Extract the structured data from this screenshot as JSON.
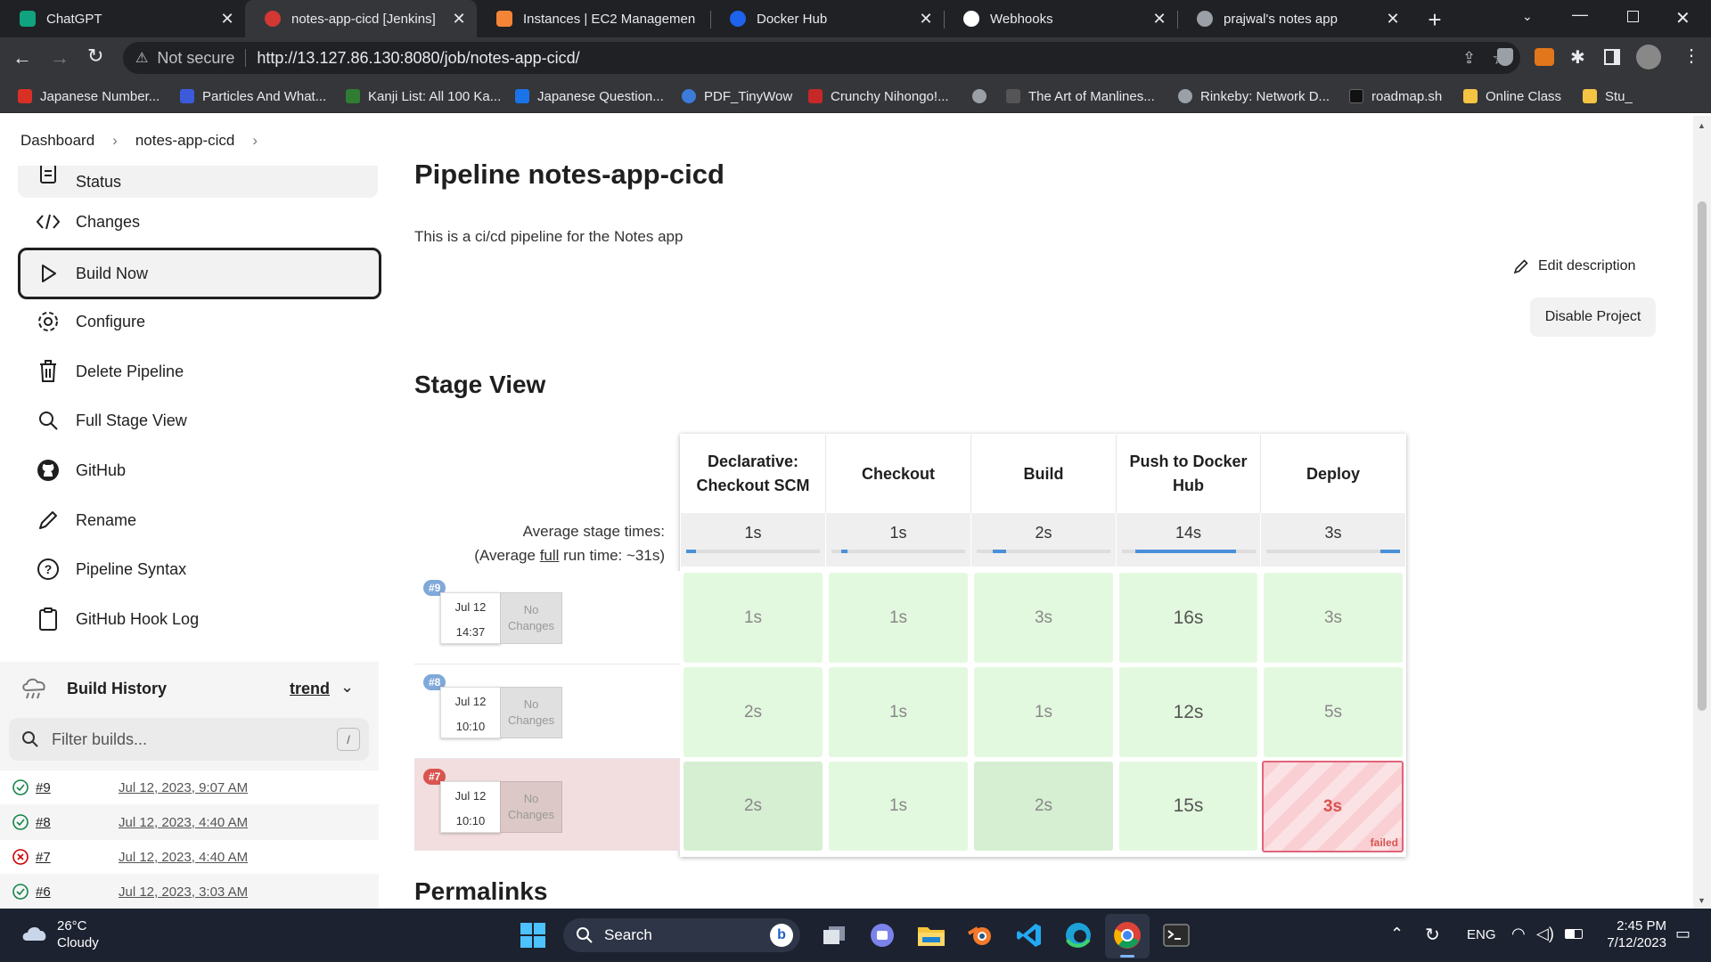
{
  "browser": {
    "tabs": [
      {
        "title": "ChatGPT",
        "favicon_color": "#10a37f"
      },
      {
        "title": "notes-app-cicd [Jenkins]",
        "favicon_color": "#d33833"
      },
      {
        "title": "Instances | EC2 Managemen",
        "favicon_color": "#f58536"
      },
      {
        "title": "Docker Hub",
        "favicon_color": "#1d63ed"
      },
      {
        "title": "Webhooks",
        "favicon_color": "#ffffff"
      },
      {
        "title": "prajwal's notes app",
        "favicon_color": "#9aa0a6"
      }
    ],
    "active_tab": 1,
    "security_label": "Not secure",
    "url": "http://13.127.86.130:8080/job/notes-app-cicd/",
    "bookmarks": [
      {
        "label": "Japanese Number...",
        "color": "#d93025"
      },
      {
        "label": "Particles And What...",
        "color": "#3b5bdb"
      },
      {
        "label": "Kanji List: All 100 Ka...",
        "color": "#2e7d32"
      },
      {
        "label": "Japanese Question...",
        "color": "#1a73e8"
      },
      {
        "label": "PDF_TinyWow",
        "color": "#3c7bd9"
      },
      {
        "label": "Crunchy Nihongo!...",
        "color": "#c62828"
      },
      {
        "label": "",
        "color": "#9aa0a6"
      },
      {
        "label": "The Art of Manlines...",
        "color": "#555555"
      },
      {
        "label": "Rinkeby: Network D...",
        "color": "#9aa0a6"
      },
      {
        "label": "roadmap.sh",
        "color": "#111111"
      },
      {
        "label": "Online Class",
        "color": "#f6c443"
      },
      {
        "label": "Stu_",
        "color": "#f6c443"
      }
    ]
  },
  "breadcrumb": [
    "Dashboard",
    "notes-app-cicd"
  ],
  "sidebar": {
    "items": [
      {
        "label": "Status",
        "icon": "document-icon"
      },
      {
        "label": "Changes",
        "icon": "code-icon"
      },
      {
        "label": "Build Now",
        "icon": "play-icon"
      },
      {
        "label": "Configure",
        "icon": "gear-icon"
      },
      {
        "label": "Delete Pipeline",
        "icon": "trash-icon"
      },
      {
        "label": "Full Stage View",
        "icon": "search-icon"
      },
      {
        "label": "GitHub",
        "icon": "github-icon"
      },
      {
        "label": "Rename",
        "icon": "pencil-icon"
      },
      {
        "label": "Pipeline Syntax",
        "icon": "help-icon"
      },
      {
        "label": "GitHub Hook Log",
        "icon": "clipboard-icon"
      }
    ],
    "build_history": {
      "title": "Build History",
      "trend_label": "trend",
      "filter_placeholder": "Filter builds...",
      "filter_shortcut": "/",
      "builds": [
        {
          "number": "#9",
          "date": "Jul 12, 2023, 9:07 AM",
          "status": "success"
        },
        {
          "number": "#8",
          "date": "Jul 12, 2023, 4:40 AM",
          "status": "success"
        },
        {
          "number": "#7",
          "date": "Jul 12, 2023, 4:40 AM",
          "status": "failed"
        },
        {
          "number": "#6",
          "date": "Jul 12, 2023, 3:03 AM",
          "status": "success"
        }
      ]
    }
  },
  "main": {
    "title": "Pipeline notes-app-cicd",
    "description": "This is a ci/cd pipeline for the Notes app",
    "edit_description": "Edit description",
    "disable_project": "Disable Project",
    "stage_view_title": "Stage View",
    "avg_stage_label": "Average stage times:",
    "avg_run_prefix": "(Average ",
    "avg_run_link": "full",
    "avg_run_suffix": " run time: ~31s)",
    "stages": [
      {
        "name": "Declarative: Checkout SCM",
        "avg": "1s",
        "bar_start": 0.0,
        "bar_fill": 0.07
      },
      {
        "name": "Checkout",
        "avg": "1s",
        "bar_start": 0.07,
        "bar_fill": 0.05
      },
      {
        "name": "Build",
        "avg": "2s",
        "bar_start": 0.12,
        "bar_fill": 0.1
      },
      {
        "name": "Push to Docker Hub",
        "avg": "14s",
        "bar_start": 0.1,
        "bar_fill": 0.75
      },
      {
        "name": "Deploy",
        "avg": "3s",
        "bar_start": 0.85,
        "bar_fill": 0.15
      }
    ],
    "runs": [
      {
        "badge": "#9",
        "date": "Jul 12",
        "time": "14:37",
        "changes": "No Changes",
        "status": "success",
        "durations": [
          "1s",
          "1s",
          "3s",
          "16s",
          "3s"
        ]
      },
      {
        "badge": "#8",
        "date": "Jul 12",
        "time": "10:10",
        "changes": "No Changes",
        "status": "success",
        "durations": [
          "2s",
          "1s",
          "1s",
          "12s",
          "5s"
        ]
      },
      {
        "badge": "#7",
        "date": "Jul 12",
        "time": "10:10",
        "changes": "No Changes",
        "status": "failed",
        "durations": [
          "2s",
          "1s",
          "2s",
          "15s",
          "3s"
        ],
        "failed_label": "failed"
      }
    ],
    "permalinks_title": "Permalinks"
  },
  "taskbar": {
    "weather_temp": "26°C",
    "weather_desc": "Cloudy",
    "search_label": "Search",
    "language": "ENG",
    "time": "2:45 PM",
    "date": "7/12/2023"
  }
}
